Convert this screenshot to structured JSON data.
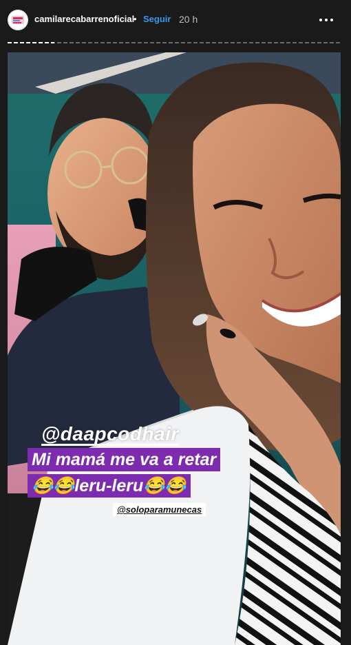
{
  "header": {
    "username": "camilarecabarrenoficial",
    "separator": "•",
    "follow_label": "Seguir",
    "time": "20 h",
    "avatar_icon": "profile-avatar-icon",
    "more_icon": "more-options-icon"
  },
  "progress": {
    "segments": 1,
    "progress_fraction": 0.14
  },
  "story": {
    "mention_main": "@daapcodhair",
    "caption_line1": "Mi mamá me va a retar",
    "caption_line2": "😂😂leru-leru😂😂",
    "mention_small": "@soloparamunecas",
    "accent_color": "#7d2cb0"
  }
}
